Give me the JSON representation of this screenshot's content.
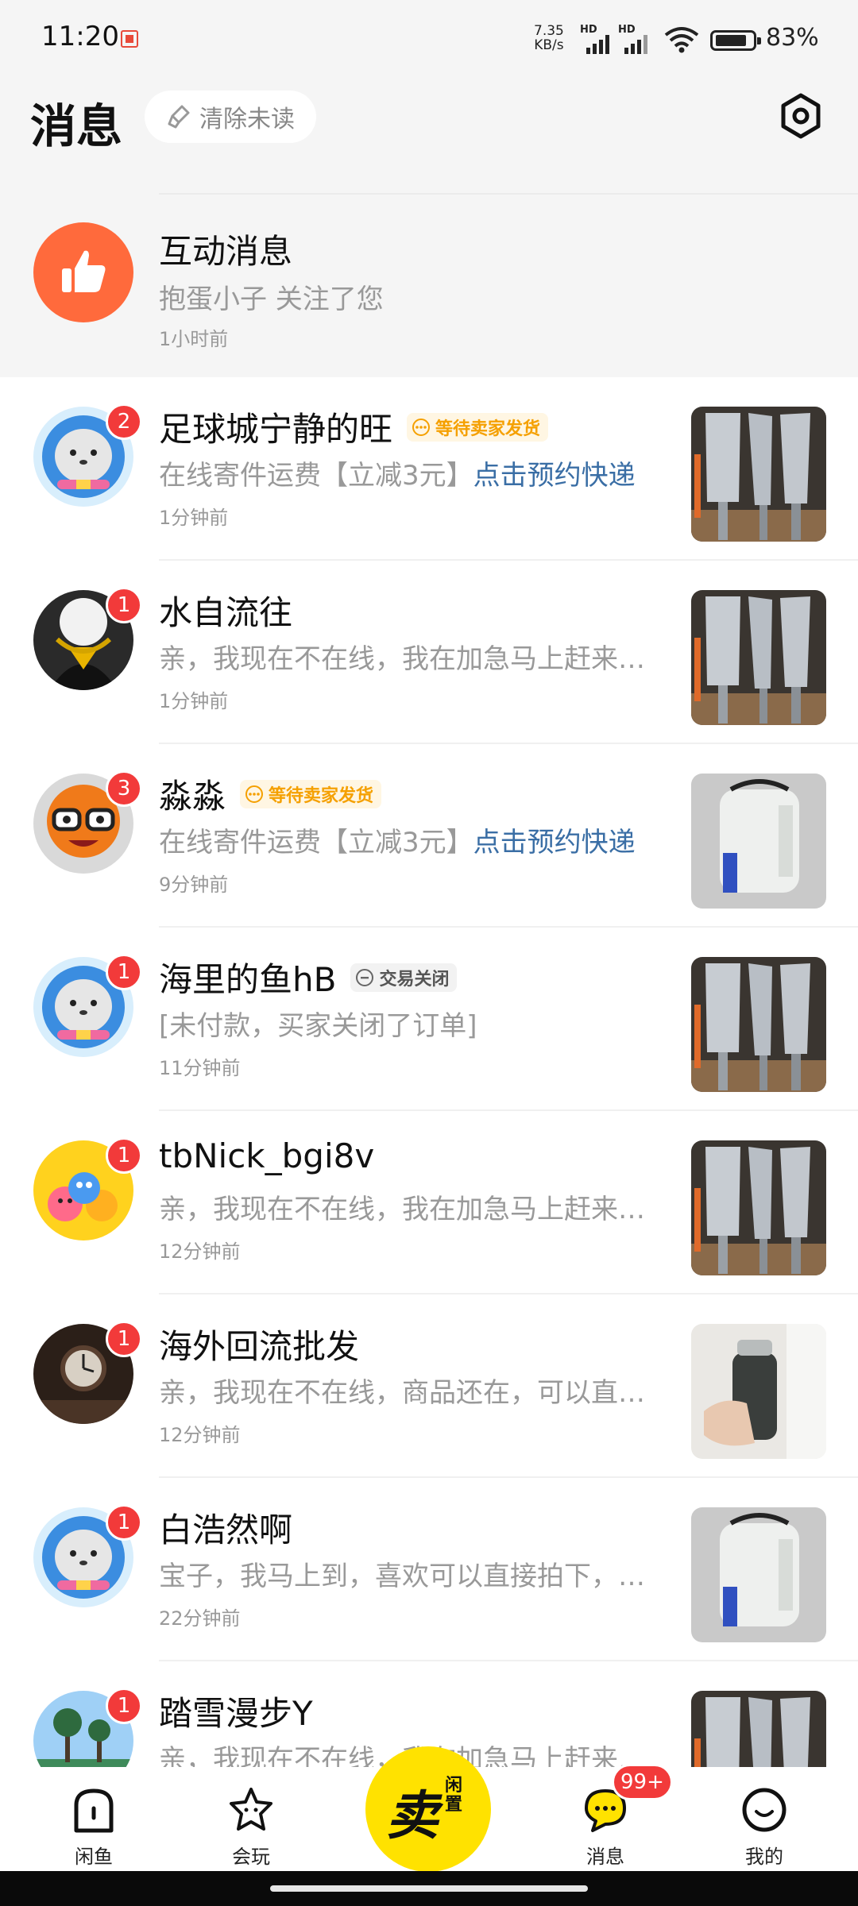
{
  "status_bar": {
    "time": "11:20",
    "net_speed_value": "7.35",
    "net_speed_unit": "KB/s",
    "hd_label": "HD",
    "battery": "83%"
  },
  "header": {
    "title": "消息",
    "clear_unread": "清除未读"
  },
  "interaction": {
    "title": "互动消息",
    "subtitle": "抱蛋小子 关注了您",
    "time": "1小时前"
  },
  "chats": [
    {
      "name": "足球城宁静的旺",
      "badge": "2",
      "tag": "等待卖家发货",
      "tag_type": "await",
      "preview": "在线寄件运费【立减3元】",
      "preview_link": "点击预约快递",
      "time": "1分钟前"
    },
    {
      "name": "水自流往",
      "badge": "1",
      "preview": "亲，我现在不在线，我在加急马上赶来…",
      "time": "1分钟前"
    },
    {
      "name": "淼淼",
      "badge": "3",
      "tag": "等待卖家发货",
      "tag_type": "await",
      "preview": "在线寄件运费【立减3元】",
      "preview_link": "点击预约快递",
      "time": "9分钟前"
    },
    {
      "name": "海里的鱼hB",
      "badge": "1",
      "tag": "交易关闭",
      "tag_type": "closed",
      "preview": "[未付款，买家关闭了订单]",
      "time": "11分钟前"
    },
    {
      "name": "tbNick_bgi8v",
      "badge": "1",
      "preview": "亲，我现在不在线，我在加急马上赶来…",
      "time": "12分钟前"
    },
    {
      "name": "海外回流批发",
      "badge": "1",
      "preview": "亲，我现在不在线，商品还在，可以直…",
      "time": "12分钟前"
    },
    {
      "name": "白浩然啊",
      "badge": "1",
      "preview": "宝子，我马上到，喜欢可以直接拍下，…",
      "time": "22分钟前"
    },
    {
      "name": "踏雪漫步Y",
      "badge": "1",
      "preview": "亲，我现在不在线，我在加急马上赶来…",
      "time": ""
    }
  ],
  "nav": {
    "home": "闲鱼",
    "play": "会玩",
    "sell_big": "卖",
    "sell_small": "闲置",
    "messages": "消息",
    "messages_badge": "99+",
    "me": "我的"
  },
  "colors": {
    "accent_yellow": "#ffe200",
    "badge_red": "#f23a3a",
    "like_orange": "#ff6a3c",
    "link_blue": "#3a6ea5",
    "tag_orange": "#f5a000"
  }
}
